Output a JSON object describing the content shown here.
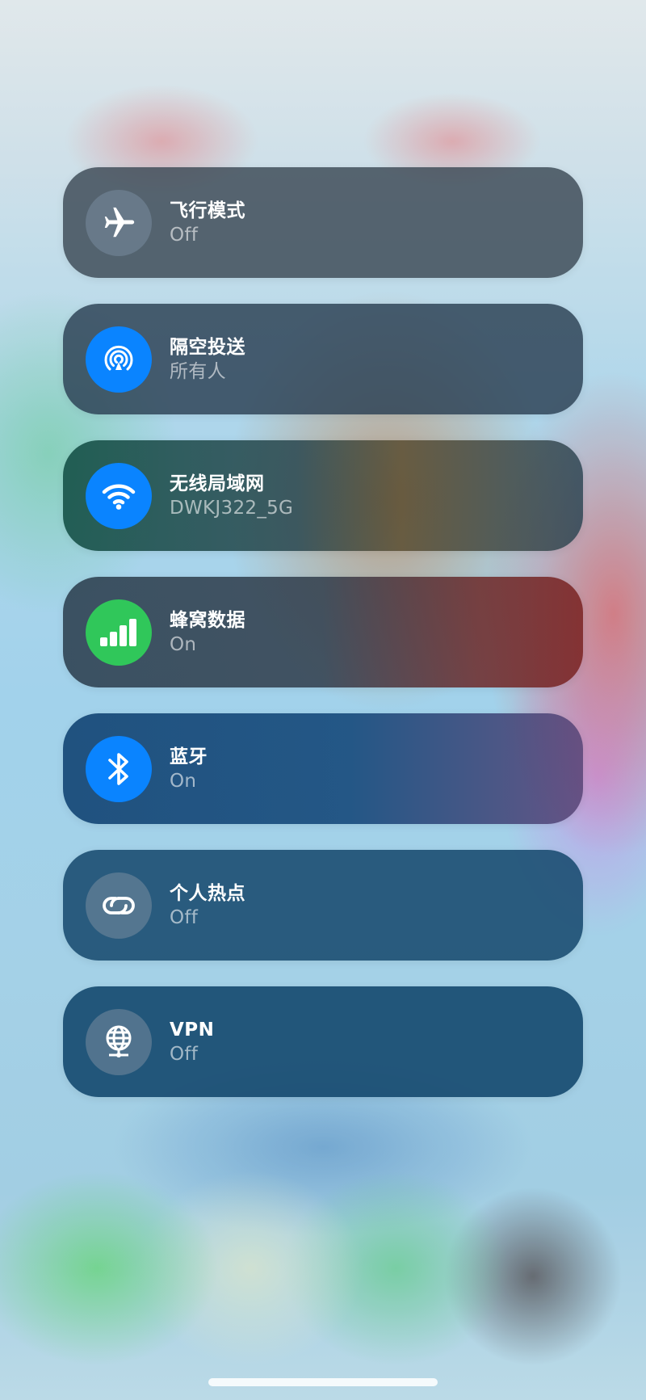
{
  "toggles": [
    {
      "name": "飞行模式",
      "status": "Off",
      "icon": "airplane-icon",
      "state": "off"
    },
    {
      "name": "隔空投送",
      "status": "所有人",
      "icon": "airdrop-icon",
      "state": "on"
    },
    {
      "name": "无线局域网",
      "status": "DWKJ322_5G",
      "icon": "wifi-icon",
      "state": "on"
    },
    {
      "name": "蜂窝数据",
      "status": "On",
      "icon": "cellular-icon",
      "state": "on"
    },
    {
      "name": "蓝牙",
      "status": "On",
      "icon": "bluetooth-icon",
      "state": "on"
    },
    {
      "name": "个人热点",
      "status": "Off",
      "icon": "hotspot-icon",
      "state": "off"
    },
    {
      "name": "VPN",
      "status": "Off",
      "icon": "vpn-globe-icon",
      "state": "off"
    }
  ],
  "colors": {
    "active_blue": "#0a84ff",
    "active_green": "#30c75a",
    "inactive_gray": "#788c9e"
  }
}
